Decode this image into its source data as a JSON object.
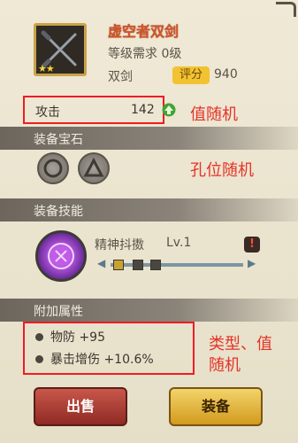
{
  "item": {
    "name": "虚空者双剑",
    "level_requirement": "等级需求 0级",
    "type": "双剑",
    "score_label": "评分",
    "score_value": "940",
    "stars": "★★",
    "icon": "crossed-swords-icon"
  },
  "attack": {
    "label": "攻击",
    "value": "142",
    "trend_icon": "arrow-up-icon",
    "annotation": "值随机"
  },
  "gems": {
    "title": "装备宝石",
    "slots": [
      "circle-slot",
      "triangle-slot"
    ],
    "annotation": "孔位随机"
  },
  "skill": {
    "title": "装备技能",
    "name": "精神抖擞",
    "level": "Lv.1",
    "icon": "purple-skill-icon",
    "warning_icon": "exclamation-icon"
  },
  "extra_attrs": {
    "title": "附加属性",
    "items": [
      "物防 +95",
      "暴击增伤 +10.6%"
    ],
    "annotation_line1": "类型、值",
    "annotation_line2": "随机"
  },
  "buttons": {
    "sell": "出售",
    "equip": "装备"
  },
  "colors": {
    "annotation_red": "#e53328",
    "name_orange": "#d3552a",
    "score_badge": "#f3c230",
    "sell_button": "#b14236",
    "equip_button": "#e8bb3a"
  }
}
